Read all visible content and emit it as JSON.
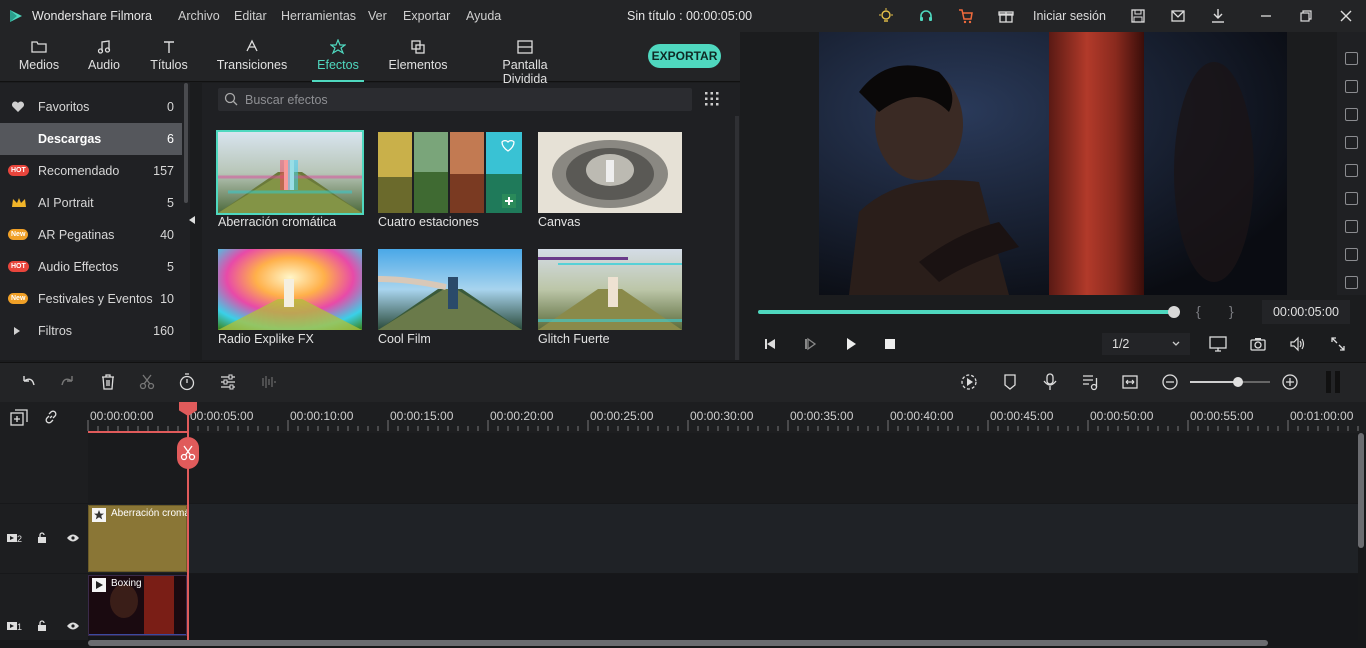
{
  "app": {
    "name": "Wondershare Filmora",
    "doc_title": "Sin título : 00:00:05:00",
    "login_label": "Iniciar sesión",
    "menu": [
      "Archivo",
      "Editar",
      "Herramientas",
      "Ver",
      "Exportar",
      "Ayuda"
    ]
  },
  "tabs": [
    {
      "label": "Medios",
      "icon": "folder-icon"
    },
    {
      "label": "Audio",
      "icon": "music-note-icon"
    },
    {
      "label": "Títulos",
      "icon": "text-icon"
    },
    {
      "label": "Transiciones",
      "icon": "transition-icon"
    },
    {
      "label": "Efectos",
      "icon": "effects-icon",
      "active": true
    },
    {
      "label": "Elementos",
      "icon": "elements-icon"
    },
    {
      "label": "Pantalla Dividida",
      "icon": "split-screen-icon"
    }
  ],
  "export_label": "EXPORTAR",
  "sidebar": {
    "items": [
      {
        "label": "Favoritos",
        "count": "0",
        "icon": "heart-icon"
      },
      {
        "label": "Descargas",
        "count": "6",
        "selected": true
      },
      {
        "label": "Recomendado",
        "count": "157",
        "badge": "HOT"
      },
      {
        "label": "AI Portrait",
        "count": "5",
        "icon": "crown-icon"
      },
      {
        "label": "AR Pegatinas",
        "count": "40",
        "badge": "New"
      },
      {
        "label": "Audio Effectos",
        "count": "5",
        "badge": "HOT"
      },
      {
        "label": "Festivales y Eventos",
        "count": "10",
        "badge": "New"
      },
      {
        "label": "Filtros",
        "count": "160",
        "icon": "chevron-right-icon"
      }
    ]
  },
  "search": {
    "placeholder": "Buscar efectos"
  },
  "effects": [
    {
      "label": "Aberración cromática",
      "selected": true
    },
    {
      "label": "Cuatro estaciones"
    },
    {
      "label": "Canvas"
    },
    {
      "label": "Radio Explike FX"
    },
    {
      "label": "Cool Film"
    },
    {
      "label": "Glitch Fuerte"
    }
  ],
  "preview": {
    "timecode": "00:00:05:00",
    "progress": 1.0,
    "brace_open": "{",
    "brace_close": "}",
    "zoom": "1/2"
  },
  "timeline": {
    "ruler": [
      "00:00:00:00",
      "00:00:05:00",
      "00:00:10:00",
      "00:00:15:00",
      "00:00:20:00",
      "00:00:25:00",
      "00:00:30:00",
      "00:00:35:00",
      "00:00:40:00",
      "00:00:45:00",
      "00:00:50:00",
      "00:00:55:00",
      "00:01:00:00"
    ],
    "tracks": [
      {
        "number": "2",
        "clip": "Aberración cromática"
      },
      {
        "number": "1",
        "clip": "Boxing"
      }
    ],
    "zoom_level": 0.6
  },
  "colors": {
    "accent": "#4fd8bf",
    "playhead": "#e05b5b",
    "effect_clip": "#8a7636"
  }
}
